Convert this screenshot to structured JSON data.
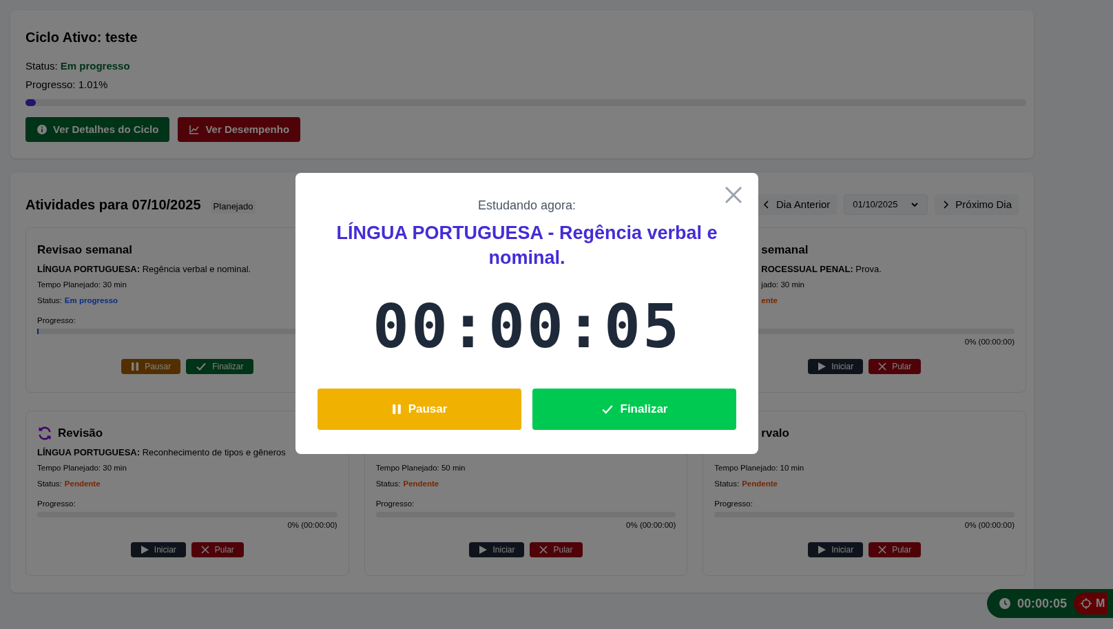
{
  "cycle": {
    "title": "Ciclo Ativo: teste",
    "status_label": "Status:",
    "status": "Em progresso",
    "progress_text": "Progresso: 1.01%",
    "level": 0.0101,
    "buttons": [
      {
        "kind": "details",
        "label": "Ver Detalhes do Ciclo"
      },
      {
        "kind": "performance",
        "label": "Ver Desempenho"
      }
    ]
  },
  "activities": {
    "title": "Atividades para 07/10/2025",
    "badge": "Planejado",
    "prev_button": "Dia Anterior",
    "date_select": "01/10/2025",
    "next_button": "Próximo Dia",
    "cards": [
      {
        "title": "Revisao semanal",
        "subject": "LÍNGUA PORTUGUESA:",
        "topic": "Regência verbal e nominal.",
        "planned": "Tempo Planejado: 30 min",
        "status_label": "Status:",
        "status": "Em progresso",
        "progress_label": "Progresso:",
        "level": 0.003,
        "actions": [
          {
            "kind": "pause",
            "label": "Pausar"
          },
          {
            "kind": "finish",
            "label": "Finalizar"
          }
        ]
      },
      {
        "title": "semanal",
        "subject": "ROCESSUAL PENAL:",
        "topic": "Prova.",
        "planned": "jado: 30 min",
        "status": "ente",
        "percent": "0% (00:00:00)",
        "actions": [
          {
            "kind": "start",
            "label": "Iniciar"
          },
          {
            "kind": "skip",
            "label": "Pular"
          }
        ]
      },
      {
        "title": "Revisão",
        "subject": "LÍNGUA PORTUGUESA:",
        "topic": "Reconhecimento de tipos e gêneros",
        "planned": "Tempo Planejado: 30 min",
        "status_label": "Status:",
        "status": "Pendente",
        "progress_label": "Progresso:",
        "percent": "0% (00:00:00)",
        "actions": [
          {
            "kind": "start",
            "label": "Iniciar"
          },
          {
            "kind": "skip",
            "label": "Pular"
          }
        ]
      },
      {
        "planned": "Tempo Planejado: 50 min",
        "status_label": "Status:",
        "status": "Pendente",
        "progress_label": "Progresso:",
        "percent": "0% (00:00:00)",
        "actions": [
          {
            "kind": "start",
            "label": "Iniciar"
          },
          {
            "kind": "skip",
            "label": "Pular"
          }
        ]
      },
      {
        "title": "rvalo",
        "planned": "Tempo Planejado: 10 min",
        "status_label": "Status:",
        "status": "Pendente",
        "progress_label": "Progresso:",
        "percent": "0% (00:00:00)",
        "actions": [
          {
            "kind": "start",
            "label": "Iniciar"
          },
          {
            "kind": "skip",
            "label": "Pular"
          }
        ]
      }
    ]
  },
  "modal": {
    "heading": "Estudando agora:",
    "title": "LÍNGUA PORTUGUESA - Regência verbal e nominal.",
    "timer": "00:00:05",
    "buttons": [
      {
        "kind": "pause",
        "label": "Pausar"
      },
      {
        "kind": "finish",
        "label": "Finalizar"
      }
    ]
  },
  "floating_timer": {
    "time": "00:00:05",
    "button": "M"
  }
}
